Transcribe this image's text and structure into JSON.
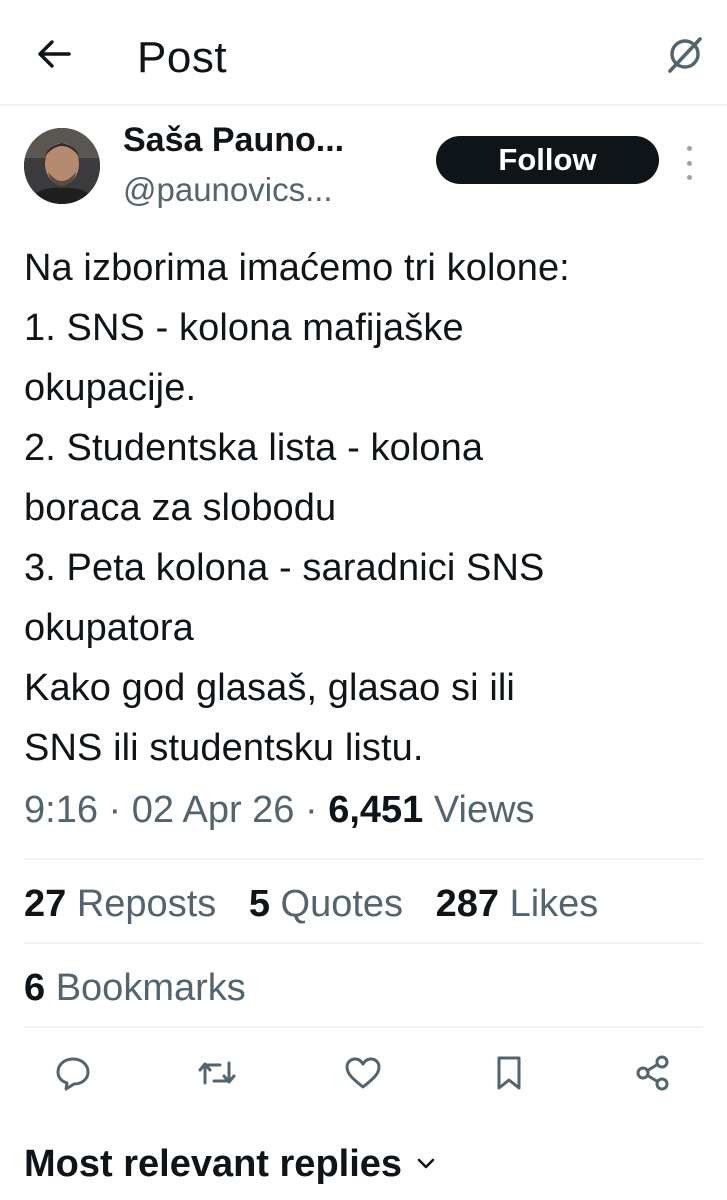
{
  "header": {
    "title": "Post",
    "back_icon": "arrow-left-icon",
    "grok_icon": "grok-icon"
  },
  "author": {
    "display_name": "Saša Pauno...",
    "handle": "@paunovics...",
    "follow_label": "Follow",
    "more_icon": "more-vertical-icon"
  },
  "post": {
    "text": "Na izborima imaćemo tri kolone:\n1. SNS - kolona mafijaške\nokupacije.\n2. Studentska lista - kolona\nboraca za slobodu\n3. Peta kolona - saradnici SNS\nokupatora\nKako god glasaš, glasao si ili\nSNS ili studentsku listu.",
    "time": "9:16",
    "separator": "·",
    "date": "02 Apr 26",
    "views_count": "6,451",
    "views_label": "Views"
  },
  "stats": {
    "reposts_count": "27",
    "reposts_label": "Reposts",
    "quotes_count": "5",
    "quotes_label": "Quotes",
    "likes_count": "287",
    "likes_label": "Likes",
    "bookmarks_count": "6",
    "bookmarks_label": "Bookmarks"
  },
  "actions": [
    {
      "icon": "reply-icon"
    },
    {
      "icon": "repost-icon"
    },
    {
      "icon": "like-icon"
    },
    {
      "icon": "bookmark-icon"
    },
    {
      "icon": "share-icon"
    }
  ],
  "replies": {
    "label": "Most relevant replies",
    "chevron_icon": "chevron-down-icon"
  },
  "colors": {
    "text": "#0f1419",
    "secondary": "#536471",
    "divider": "#eff3f4",
    "follow_bg": "#0f1419"
  }
}
